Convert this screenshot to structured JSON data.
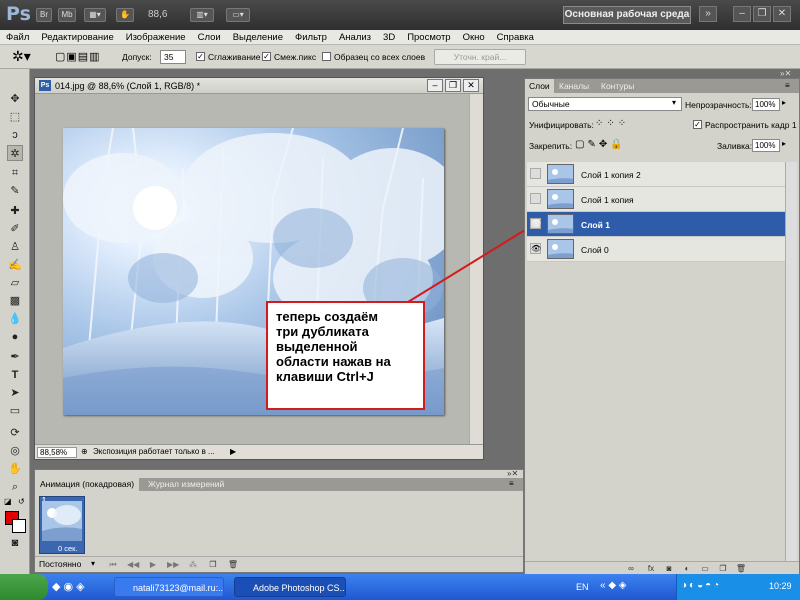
{
  "app_bar": {
    "logo": "Ps",
    "btn_br": "Br",
    "btn_mb": "Mb",
    "zoom": "88,6",
    "workspace": "Основная рабочая среда",
    "icons": [
      "bridge-icon",
      "mini-bridge-icon",
      "view-extras-icon",
      "zoom-level",
      "arrange-docs-icon",
      "screen-mode-icon",
      "expand-icon",
      "minimize-icon",
      "restore-icon",
      "close-icon"
    ]
  },
  "menu": [
    "Файл",
    "Редактирование",
    "Изображение",
    "Слои",
    "Выделение",
    "Фильтр",
    "Анализ",
    "3D",
    "Просмотр",
    "Окно",
    "Справка"
  ],
  "options_bar": {
    "tolerance_label": "Допуск:",
    "tolerance_value": "35",
    "antialias_label": "Сглаживание",
    "contiguous_label": "Смеж.пикс",
    "sample_all_label": "Образец со всех слоев",
    "refine_edge_label": "Уточн. край..."
  },
  "document": {
    "title": "014.jpg @ 88,6% (Слой 1, RGB/8) *",
    "zoom": "88,58%",
    "status": "Экспозиция работает только в ..."
  },
  "callout": {
    "text": "теперь создаём\nтри дубликата\nвыделенной\nобласти нажав на\nклавиши Ctrl+J",
    "border_color": "#d31b1b"
  },
  "animation": {
    "tab_animation": "Анимация (покадровая)",
    "tab_measure": "Журнал измерений",
    "frame_number": "1",
    "frame_delay": "0 сек.",
    "loop": "Постоянно"
  },
  "layers_panel": {
    "tabs": [
      "Слои",
      "Каналы",
      "Контуры"
    ],
    "blend_mode": "Обычные",
    "opacity_label": "Непрозрачность:",
    "opacity_value": "100%",
    "unify_label": "Унифицировать:",
    "propagate_label": "Распространить кадр 1",
    "lock_label": "Закрепить:",
    "fill_label": "Заливка:",
    "fill_value": "100%",
    "layers": [
      {
        "name": "Слой 1 копия 2",
        "visible": false,
        "selected": false
      },
      {
        "name": "Слой 1 копия",
        "visible": false,
        "selected": false
      },
      {
        "name": "Слой 1",
        "visible": true,
        "selected": true
      },
      {
        "name": "Слой 0",
        "visible": true,
        "selected": false
      }
    ]
  },
  "taskbar": {
    "task_mail": "natali73123@mail.ru:...",
    "task_ps": "Adobe Photoshop CS...",
    "lang": "EN",
    "clock": "10:29"
  },
  "colors": {
    "selection": "#2f5ca8",
    "foreground": "#e00000",
    "background": "#ffffff",
    "arrow": "#d31b1b"
  }
}
